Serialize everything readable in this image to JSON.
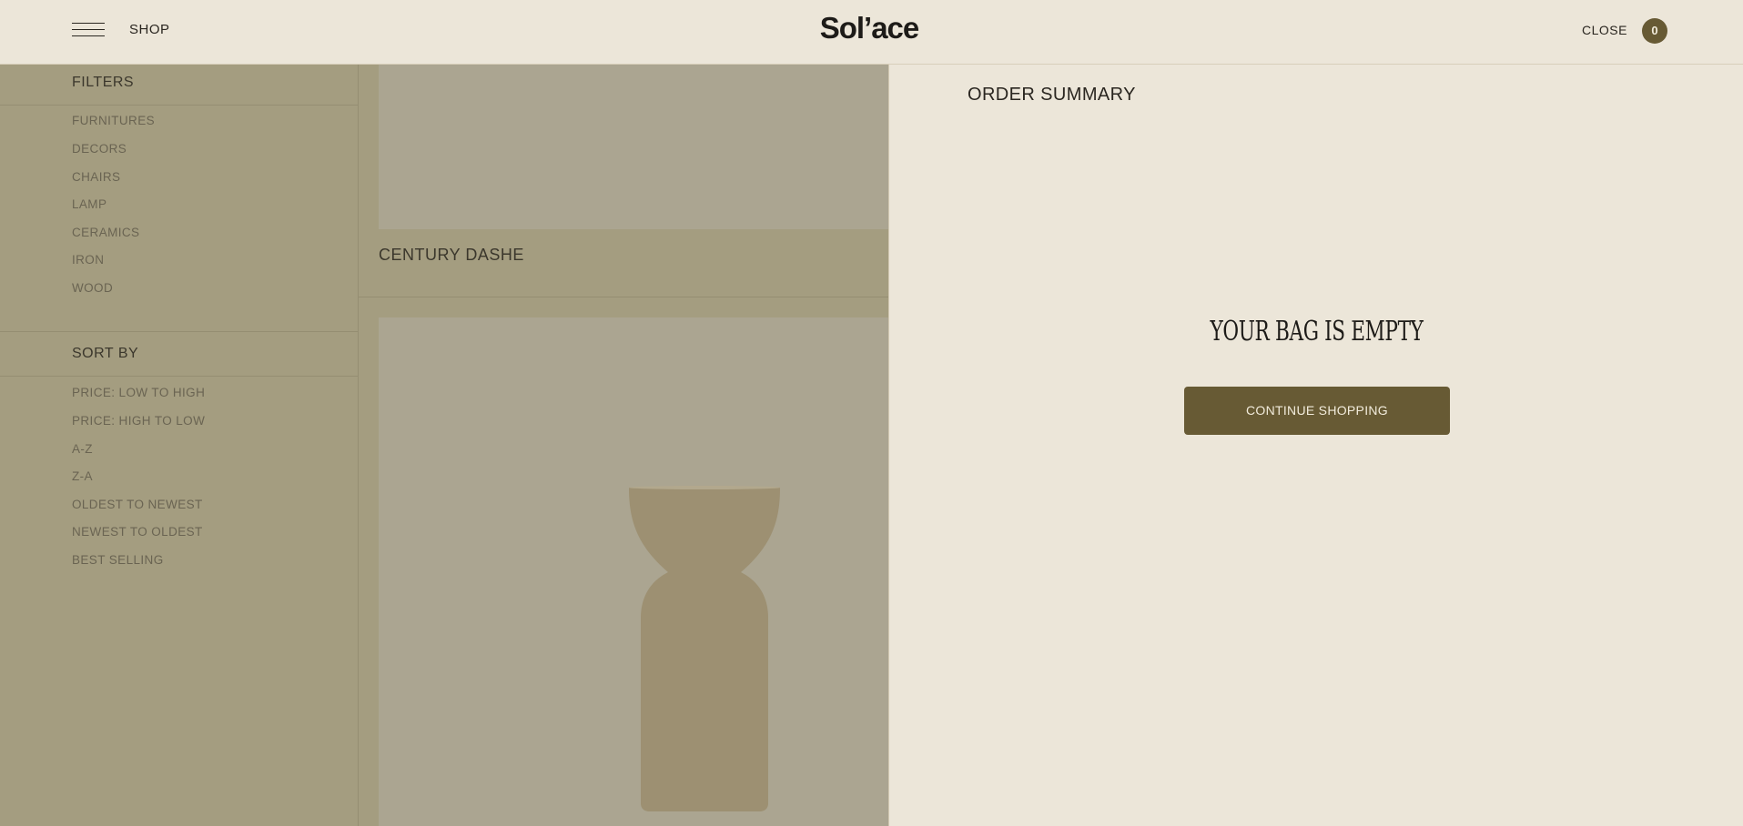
{
  "header": {
    "menu_icon": "hamburger-icon",
    "shop_label": "SHOP",
    "logo_text": "Sol’ace",
    "close_label": "CLOSE",
    "bag_count": "0"
  },
  "sidebar": {
    "filters_heading": "FILTERS",
    "filters": [
      "FURNITURES",
      "DECORS",
      "CHAIRS",
      "LAMP",
      "CERAMICS",
      "IRON",
      "WOOD"
    ],
    "sort_heading": "SORT BY",
    "sort_options": [
      "PRICE: LOW TO HIGH",
      "PRICE: HIGH TO LOW",
      "A-Z",
      "Z-A",
      "OLDEST TO NEWEST",
      "NEWEST TO OLDEST",
      "BEST SELLING"
    ]
  },
  "products": {
    "title": "CENTURY DASHE"
  },
  "order_summary": {
    "title": "ORDER SUMMARY",
    "empty_message": "YOUR BAG IS EMPTY",
    "cta_label": "CONTINUE SHOPPING"
  },
  "colors": {
    "accent": "#675a34",
    "background": "#ece6d9",
    "overlay": "#a49d80"
  }
}
